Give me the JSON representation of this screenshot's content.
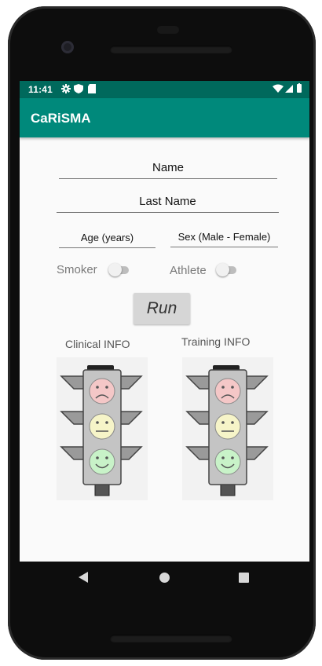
{
  "status": {
    "time": "11:41"
  },
  "app": {
    "title": "CaRiSMA",
    "accent": "#00897b",
    "status_color": "#00695c"
  },
  "form": {
    "name_hint": "Name",
    "last_name_hint": "Last Name",
    "age_hint": "Age (years)",
    "sex_hint": "Sex (Male - Female)",
    "smoker_label": "Smoker",
    "athlete_label": "Athlete",
    "smoker_on": false,
    "athlete_on": false,
    "run_label": "Run"
  },
  "results": {
    "clinical_title": "Clinical INFO",
    "training_title": "Training INFO",
    "light_colors": {
      "red": "#f4c7c7",
      "yellow": "#f6f4c8",
      "green": "#c8f2c8"
    },
    "icons": [
      "sad-face-icon",
      "neutral-face-icon",
      "happy-face-icon"
    ]
  },
  "nav": {
    "icons": [
      "back-icon",
      "home-icon",
      "recents-icon"
    ]
  }
}
